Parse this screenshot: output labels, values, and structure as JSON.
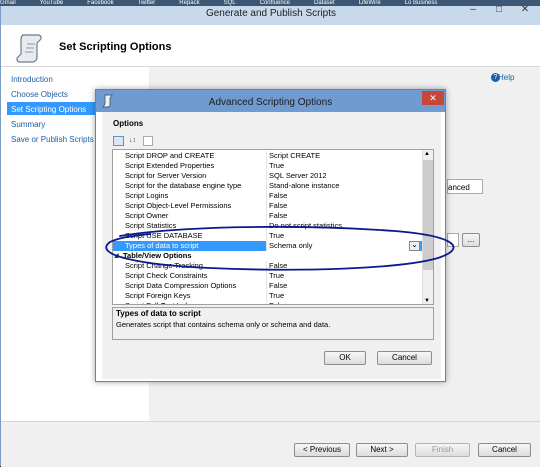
{
  "favorites_bar": [
    "Gmail",
    "YouTube",
    "Facebook",
    "Twitter",
    "Repack",
    "SQL",
    "Confluence",
    "Dataset",
    "LifeWire",
    "Lo Business"
  ],
  "wizard": {
    "title": "Generate and Publish Scripts",
    "heading": "Set Scripting Options",
    "help": "Help",
    "nav": [
      "Introduction",
      "Choose Objects",
      "Set Scripting Options",
      "Summary",
      "Save or Publish Scripts"
    ],
    "partial_button": "anced",
    "browse_button": "...",
    "buttons": {
      "previous": "< Previous",
      "next": "Next >",
      "finish": "Finish",
      "cancel": "Cancel"
    }
  },
  "dialog": {
    "title": "Advanced Scripting Options",
    "close_glyph": "✕",
    "options_label": "Options",
    "sort_glyph": "↓↕",
    "rows": [
      {
        "key": "Script DROP and CREATE",
        "value": "Script CREATE"
      },
      {
        "key": "Script Extended Properties",
        "value": "True"
      },
      {
        "key": "Script for Server Version",
        "value": "SQL Server 2012"
      },
      {
        "key": "Script for the database engine type",
        "value": "Stand-alone instance"
      },
      {
        "key": "Script Logins",
        "value": "False"
      },
      {
        "key": "Script Object-Level Permissions",
        "value": "False"
      },
      {
        "key": "Script Owner",
        "value": "False"
      },
      {
        "key": "Script Statistics",
        "value": "Do not script statistics"
      },
      {
        "key": "Script USE DATABASE",
        "value": "True"
      },
      {
        "key": "Types of data to script",
        "value": "Schema only",
        "selected": true
      },
      {
        "key": "Table/View Options",
        "value": "",
        "category": true
      },
      {
        "key": "Script Change Tracking",
        "value": "False"
      },
      {
        "key": "Script Check Constraints",
        "value": "True"
      },
      {
        "key": "Script Data Compression Options",
        "value": "False"
      },
      {
        "key": "Script Foreign Keys",
        "value": "True"
      },
      {
        "key": "Script Full-Text Indexes",
        "value": "False"
      }
    ],
    "dropdown_glyph": "⌄",
    "description": {
      "title": "Types of data to script",
      "text": "Generates script that contains schema only or schema and data."
    },
    "ok": "OK",
    "cancel": "Cancel"
  },
  "colors": {
    "accent": "#3399ff",
    "annotation_ink": "#0a1a8c",
    "close_red": "#c7463a"
  }
}
